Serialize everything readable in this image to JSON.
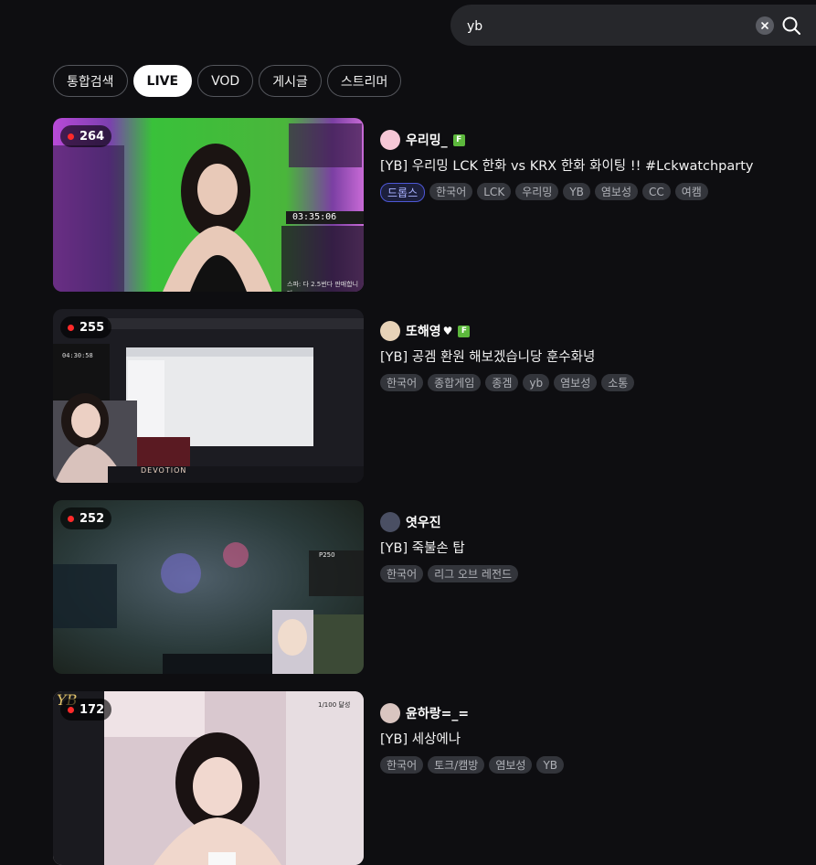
{
  "search": {
    "value": "yb"
  },
  "tabs": [
    {
      "label": "통합검색",
      "active": false
    },
    {
      "label": "LIVE",
      "active": true
    },
    {
      "label": "VOD",
      "active": false
    },
    {
      "label": "게시글",
      "active": false
    },
    {
      "label": "스트리머",
      "active": false
    }
  ],
  "streams": [
    {
      "viewers": "264",
      "streamer": "우리밍_",
      "partner_badge": "F",
      "title": "[YB] 우리밍 LCK 한화 vs KRX 한화 화이팅 !! #Lckwatchparty",
      "tags": [
        "드롭스",
        "한국어",
        "LCK",
        "우리밍",
        "YB",
        "염보성",
        "CC",
        "여캠"
      ],
      "overlay": {
        "timer": "03:35:06",
        "text": "스파: 다 2.5번다 판매합니다"
      }
    },
    {
      "viewers": "255",
      "streamer": "또해영",
      "partner_badge": "F",
      "title": "[YB] 공겜 환원 해보겠습니당 훈수화녕",
      "tags": [
        "한국어",
        "종합게임",
        "종겜",
        "yb",
        "염보성",
        "소통"
      ],
      "overlay": {
        "timer": "04:30:58",
        "text": "DEVOTION"
      }
    },
    {
      "viewers": "252",
      "streamer": "엿우진",
      "title": "[YB] 죽불손 탑",
      "tags": [
        "한국어",
        "리그 오브 레전드"
      ],
      "overlay": {
        "timer": "P250",
        "text": ""
      }
    },
    {
      "viewers": "172",
      "streamer": "윤하랑=_=",
      "title": "[YB] 세상에나",
      "tags": [
        "한국어",
        "토크/캠방",
        "염보성",
        "YB"
      ],
      "overlay": {
        "timer": "1/100 달성",
        "text": "YB"
      }
    }
  ],
  "colors": {
    "background": "#0e0e11",
    "live_dot": "#ff2a2a",
    "partner_badge": "#5cb83c",
    "drops_tag": "#4d57d6"
  }
}
